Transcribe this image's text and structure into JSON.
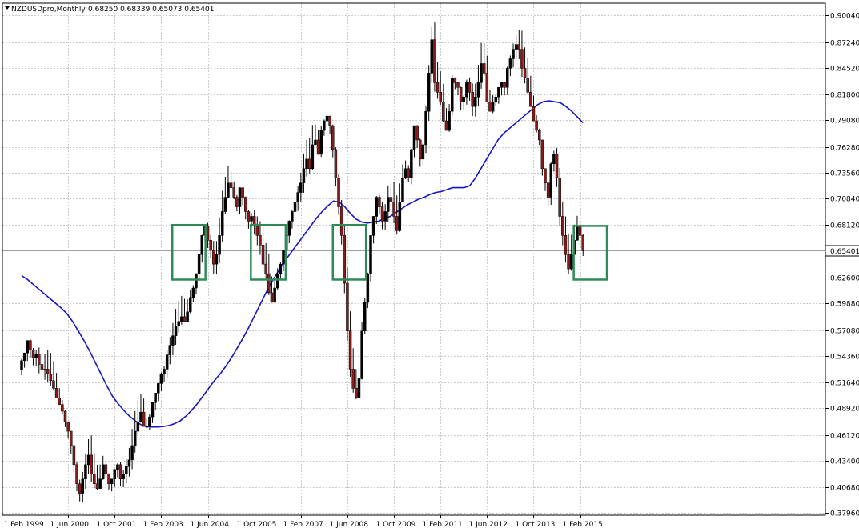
{
  "header": {
    "symbol": "NZDUSDpro,Monthly",
    "ohlc": "0.68250 0.68339 0.65073 0.65401"
  },
  "current_price_label": "0.65401",
  "colors": {
    "background": "#ffffff",
    "grid": "#c8c8c8",
    "bull": "#000000",
    "bear": "#8b1a1a",
    "wick": "#000000",
    "ma": "#1515c8",
    "box": "#2e8b57",
    "price_line": "#a0a0a0"
  },
  "chart_data": {
    "type": "candlestick",
    "ylim": [
      0.3796,
      0.904
    ],
    "y_ticks": [
      "0.90040",
      "0.87240",
      "0.84520",
      "0.81800",
      "0.79080",
      "0.76280",
      "0.73560",
      "0.70840",
      "0.68120",
      "0.65401",
      "0.62600",
      "0.59880",
      "0.57080",
      "0.54360",
      "0.51640",
      "0.48920",
      "0.46120",
      "0.43400",
      "0.40680",
      "0.37960"
    ],
    "x_ticks": [
      "1 Feb 1999",
      "1 Jun 2000",
      "1 Oct 2001",
      "1 Feb 2003",
      "1 Jun 2004",
      "1 Oct 2005",
      "1 Feb 2007",
      "1 Jun 2008",
      "1 Oct 2009",
      "1 Feb 2011",
      "1 Jun 2012",
      "1 Oct 2013",
      "1 Feb 2015"
    ],
    "current_price": 0.65401,
    "close_series": [
      0.539,
      0.547,
      0.56,
      0.55,
      0.542,
      0.546,
      0.535,
      0.529,
      0.53,
      0.525,
      0.518,
      0.51,
      0.5,
      0.493,
      0.486,
      0.475,
      0.465,
      0.45,
      0.43,
      0.41,
      0.4,
      0.415,
      0.43,
      0.44,
      0.42,
      0.41,
      0.405,
      0.415,
      0.43,
      0.42,
      0.41,
      0.415,
      0.425,
      0.43,
      0.415,
      0.42,
      0.428,
      0.435,
      0.45,
      0.465,
      0.475,
      0.485,
      0.47,
      0.47,
      0.48,
      0.495,
      0.505,
      0.515,
      0.525,
      0.53,
      0.545,
      0.555,
      0.565,
      0.575,
      0.58,
      0.585,
      0.58,
      0.59,
      0.605,
      0.615,
      0.63,
      0.65,
      0.67,
      0.68,
      0.665,
      0.655,
      0.64,
      0.65,
      0.67,
      0.695,
      0.71,
      0.725,
      0.72,
      0.71,
      0.7,
      0.72,
      0.71,
      0.695,
      0.685,
      0.69,
      0.68,
      0.67,
      0.66,
      0.64,
      0.63,
      0.61,
      0.6,
      0.615,
      0.63,
      0.64,
      0.655,
      0.67,
      0.685,
      0.695,
      0.705,
      0.715,
      0.725,
      0.74,
      0.75,
      0.74,
      0.765,
      0.77,
      0.755,
      0.78,
      0.79,
      0.795,
      0.785,
      0.76,
      0.73,
      0.7,
      0.67,
      0.62,
      0.57,
      0.53,
      0.51,
      0.5,
      0.52,
      0.57,
      0.6,
      0.63,
      0.67,
      0.69,
      0.71,
      0.7,
      0.685,
      0.695,
      0.71,
      0.705,
      0.69,
      0.675,
      0.705,
      0.73,
      0.74,
      0.73,
      0.76,
      0.785,
      0.77,
      0.75,
      0.765,
      0.8,
      0.84,
      0.875,
      0.83,
      0.82,
      0.81,
      0.79,
      0.78,
      0.8,
      0.835,
      0.83,
      0.825,
      0.81,
      0.815,
      0.83,
      0.82,
      0.805,
      0.815,
      0.83,
      0.85,
      0.84,
      0.81,
      0.8,
      0.81,
      0.815,
      0.825,
      0.83,
      0.825,
      0.845,
      0.855,
      0.865,
      0.87,
      0.865,
      0.845,
      0.835,
      0.82,
      0.805,
      0.79,
      0.78,
      0.77,
      0.74,
      0.725,
      0.71,
      0.745,
      0.755,
      0.73,
      0.69,
      0.67,
      0.65,
      0.635,
      0.65,
      0.665,
      0.68,
      0.67,
      0.654
    ],
    "ma_series": [
      0.628,
      0.624,
      0.619,
      0.614,
      0.609,
      0.604,
      0.599,
      0.594,
      0.588,
      0.58,
      0.57,
      0.56,
      0.549,
      0.537,
      0.525,
      0.513,
      0.502,
      0.494,
      0.487,
      0.481,
      0.476,
      0.472,
      0.47,
      0.4695,
      0.4695,
      0.47,
      0.471,
      0.473,
      0.476,
      0.481,
      0.487,
      0.494,
      0.502,
      0.51,
      0.518,
      0.525,
      0.533,
      0.542,
      0.552,
      0.562,
      0.573,
      0.585,
      0.597,
      0.609,
      0.62,
      0.63,
      0.64,
      0.648,
      0.656,
      0.664,
      0.672,
      0.68,
      0.688,
      0.695,
      0.701,
      0.706,
      0.705,
      0.7,
      0.693,
      0.687,
      0.684,
      0.683,
      0.684,
      0.685,
      0.688,
      0.69,
      0.694,
      0.698,
      0.702,
      0.705,
      0.708,
      0.71,
      0.713,
      0.715,
      0.716,
      0.718,
      0.72,
      0.72,
      0.72,
      0.722,
      0.73,
      0.74,
      0.75,
      0.76,
      0.77,
      0.777,
      0.782,
      0.787,
      0.792,
      0.797,
      0.802,
      0.807,
      0.81,
      0.811,
      0.81,
      0.809,
      0.805,
      0.8,
      0.794,
      0.788
    ],
    "annotation_boxes": [
      {
        "x_from": 2003.4,
        "x_to": 2004.35,
        "y_top": 0.681,
        "y_bottom": 0.6238
      },
      {
        "x_from": 2005.65,
        "x_to": 2006.65,
        "y_top": 0.681,
        "y_bottom": 0.6238
      },
      {
        "x_from": 2008.0,
        "x_to": 2008.95,
        "y_top": 0.681,
        "y_bottom": 0.6238
      },
      {
        "x_from": 2014.9,
        "x_to": 2015.85,
        "y_top": 0.68,
        "y_bottom": 0.6238
      }
    ]
  }
}
